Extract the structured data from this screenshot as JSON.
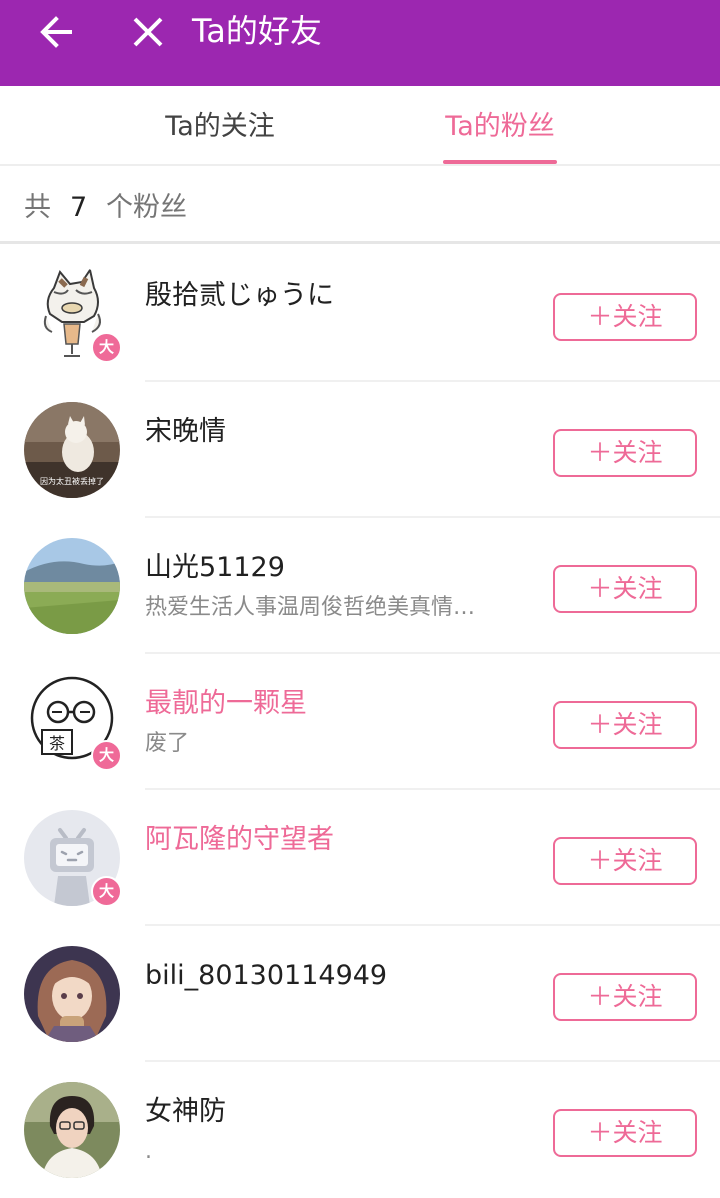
{
  "appbar": {
    "title": "Ta的好友",
    "back_icon": "arrow-left-icon",
    "close_icon": "close-icon",
    "color": "#9c27b0"
  },
  "tabs": [
    {
      "label": "Ta的关注",
      "active": false
    },
    {
      "label": "Ta的粉丝",
      "active": true
    }
  ],
  "count_bar": {
    "prefix": "共",
    "count": "7",
    "suffix": "个粉丝"
  },
  "accent": "#ee6a97",
  "fans": [
    {
      "name": "殷拾贰じゅうに",
      "signature": "",
      "badge": "大",
      "name_highlight": false,
      "follow_label": "＋关注"
    },
    {
      "name": "宋晚情",
      "signature": "",
      "badge": "",
      "name_highlight": false,
      "follow_label": "＋关注",
      "avatar_text": "因为太丑被丢掉了"
    },
    {
      "name": "山光51129",
      "signature": "热爱生活人事温周俊哲绝美真情…",
      "badge": "",
      "name_highlight": false,
      "follow_label": "＋关注"
    },
    {
      "name": "最靓的一颗星",
      "signature": "废了",
      "badge": "大",
      "name_highlight": true,
      "follow_label": "＋关注",
      "avatar_text": "茶"
    },
    {
      "name": "阿瓦隆的守望者",
      "signature": "",
      "badge": "大",
      "name_highlight": true,
      "follow_label": "＋关注"
    },
    {
      "name": "bili_80130114949",
      "signature": "",
      "badge": "",
      "name_highlight": false,
      "follow_label": "＋关注"
    },
    {
      "name": "女神防",
      "signature": ".",
      "badge": "",
      "name_highlight": false,
      "follow_label": "＋关注"
    }
  ]
}
